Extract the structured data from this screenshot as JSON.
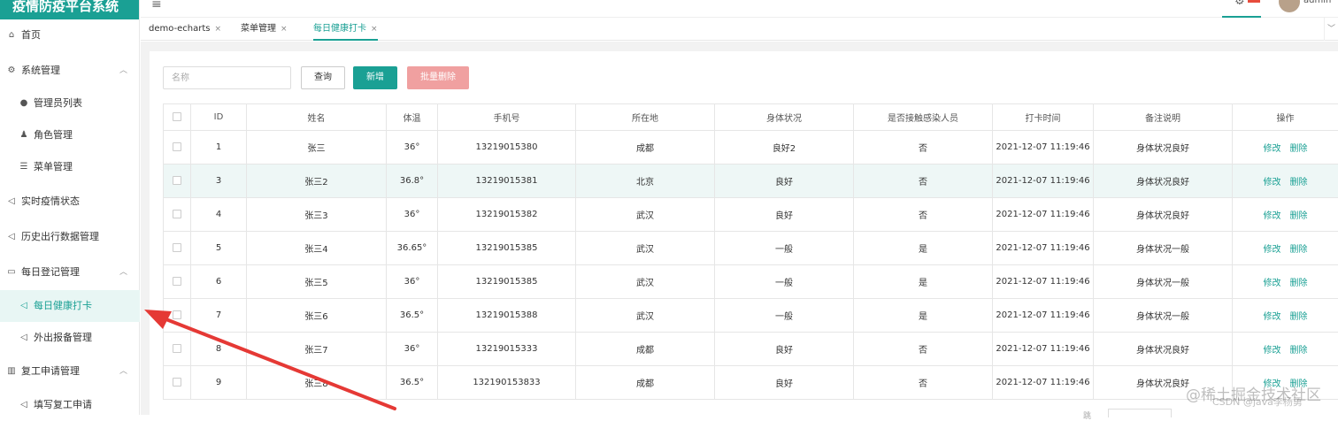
{
  "app": {
    "title": "疫情防疫平台系统",
    "brand_color": "#1aa094"
  },
  "header": {
    "menu_icon": "hamburger-icon",
    "user": "admin",
    "settings_icon": "gear-icon"
  },
  "sidebar": {
    "items": [
      {
        "label": "首页",
        "icon": "home-icon"
      },
      {
        "label": "系统管理",
        "icon": "gear-icon",
        "expanded": true
      },
      {
        "label": "管理员列表",
        "icon": "user-icon"
      },
      {
        "label": "角色管理",
        "icon": "user-role-icon"
      },
      {
        "label": "菜单管理",
        "icon": "list-icon"
      },
      {
        "label": "实时疫情状态",
        "icon": "send-icon"
      },
      {
        "label": "历史出行数据管理",
        "icon": "send-icon"
      },
      {
        "label": "每日登记管理",
        "icon": "message-icon",
        "expanded": true
      },
      {
        "label": "每日健康打卡",
        "icon": "send-icon",
        "active": true
      },
      {
        "label": "外出报备管理",
        "icon": "send-icon"
      },
      {
        "label": "复工申请管理",
        "icon": "chart-icon",
        "expanded": true
      },
      {
        "label": "填写复工申请",
        "icon": "send-icon"
      }
    ]
  },
  "tabs": [
    {
      "label": "demo-echarts"
    },
    {
      "label": "菜单管理"
    },
    {
      "label": "每日健康打卡",
      "active": true
    }
  ],
  "toolbar": {
    "search_placeholder": "名称",
    "query_label": "查询",
    "add_label": "新增",
    "batch_delete_label": "批量删除"
  },
  "table": {
    "headers": [
      "ID",
      "姓名",
      "体温",
      "手机号",
      "所在地",
      "身体状况",
      "是否接触感染人员",
      "打卡时间",
      "备注说明",
      "操作"
    ],
    "edit_label": "修改",
    "delete_label": "删除",
    "rows": [
      [
        "1",
        "张三",
        "36°",
        "13219015380",
        "成都",
        "良好2",
        "否",
        "2021-12-07 11:19:46",
        "身体状况良好"
      ],
      [
        "3",
        "张三2",
        "36.8°",
        "13219015381",
        "北京",
        "良好",
        "否",
        "2021-12-07 11:19:46",
        "身体状况良好"
      ],
      [
        "4",
        "张三3",
        "36°",
        "13219015382",
        "武汉",
        "良好",
        "否",
        "2021-12-07 11:19:46",
        "身体状况良好"
      ],
      [
        "5",
        "张三4",
        "36.65°",
        "13219015385",
        "武汉",
        "一般",
        "是",
        "2021-12-07 11:19:46",
        "身体状况一般"
      ],
      [
        "6",
        "张三5",
        "36°",
        "13219015385",
        "武汉",
        "一般",
        "是",
        "2021-12-07 11:19:46",
        "身体状况一般"
      ],
      [
        "7",
        "张三6",
        "36.5°",
        "13219015388",
        "武汉",
        "一般",
        "是",
        "2021-12-07 11:19:46",
        "身体状况一般"
      ],
      [
        "8",
        "张三7",
        "36°",
        "13219015333",
        "成都",
        "良好",
        "否",
        "2021-12-07 11:19:46",
        "身体状况良好"
      ],
      [
        "9",
        "张三8",
        "36.5°",
        "132190153833",
        "成都",
        "良好",
        "否",
        "2021-12-07 11:19:46",
        "身体状况良好"
      ]
    ]
  },
  "watermark": {
    "line1": "@稀土掘金技术社区",
    "line2": "CSDN @java李杨勇"
  }
}
